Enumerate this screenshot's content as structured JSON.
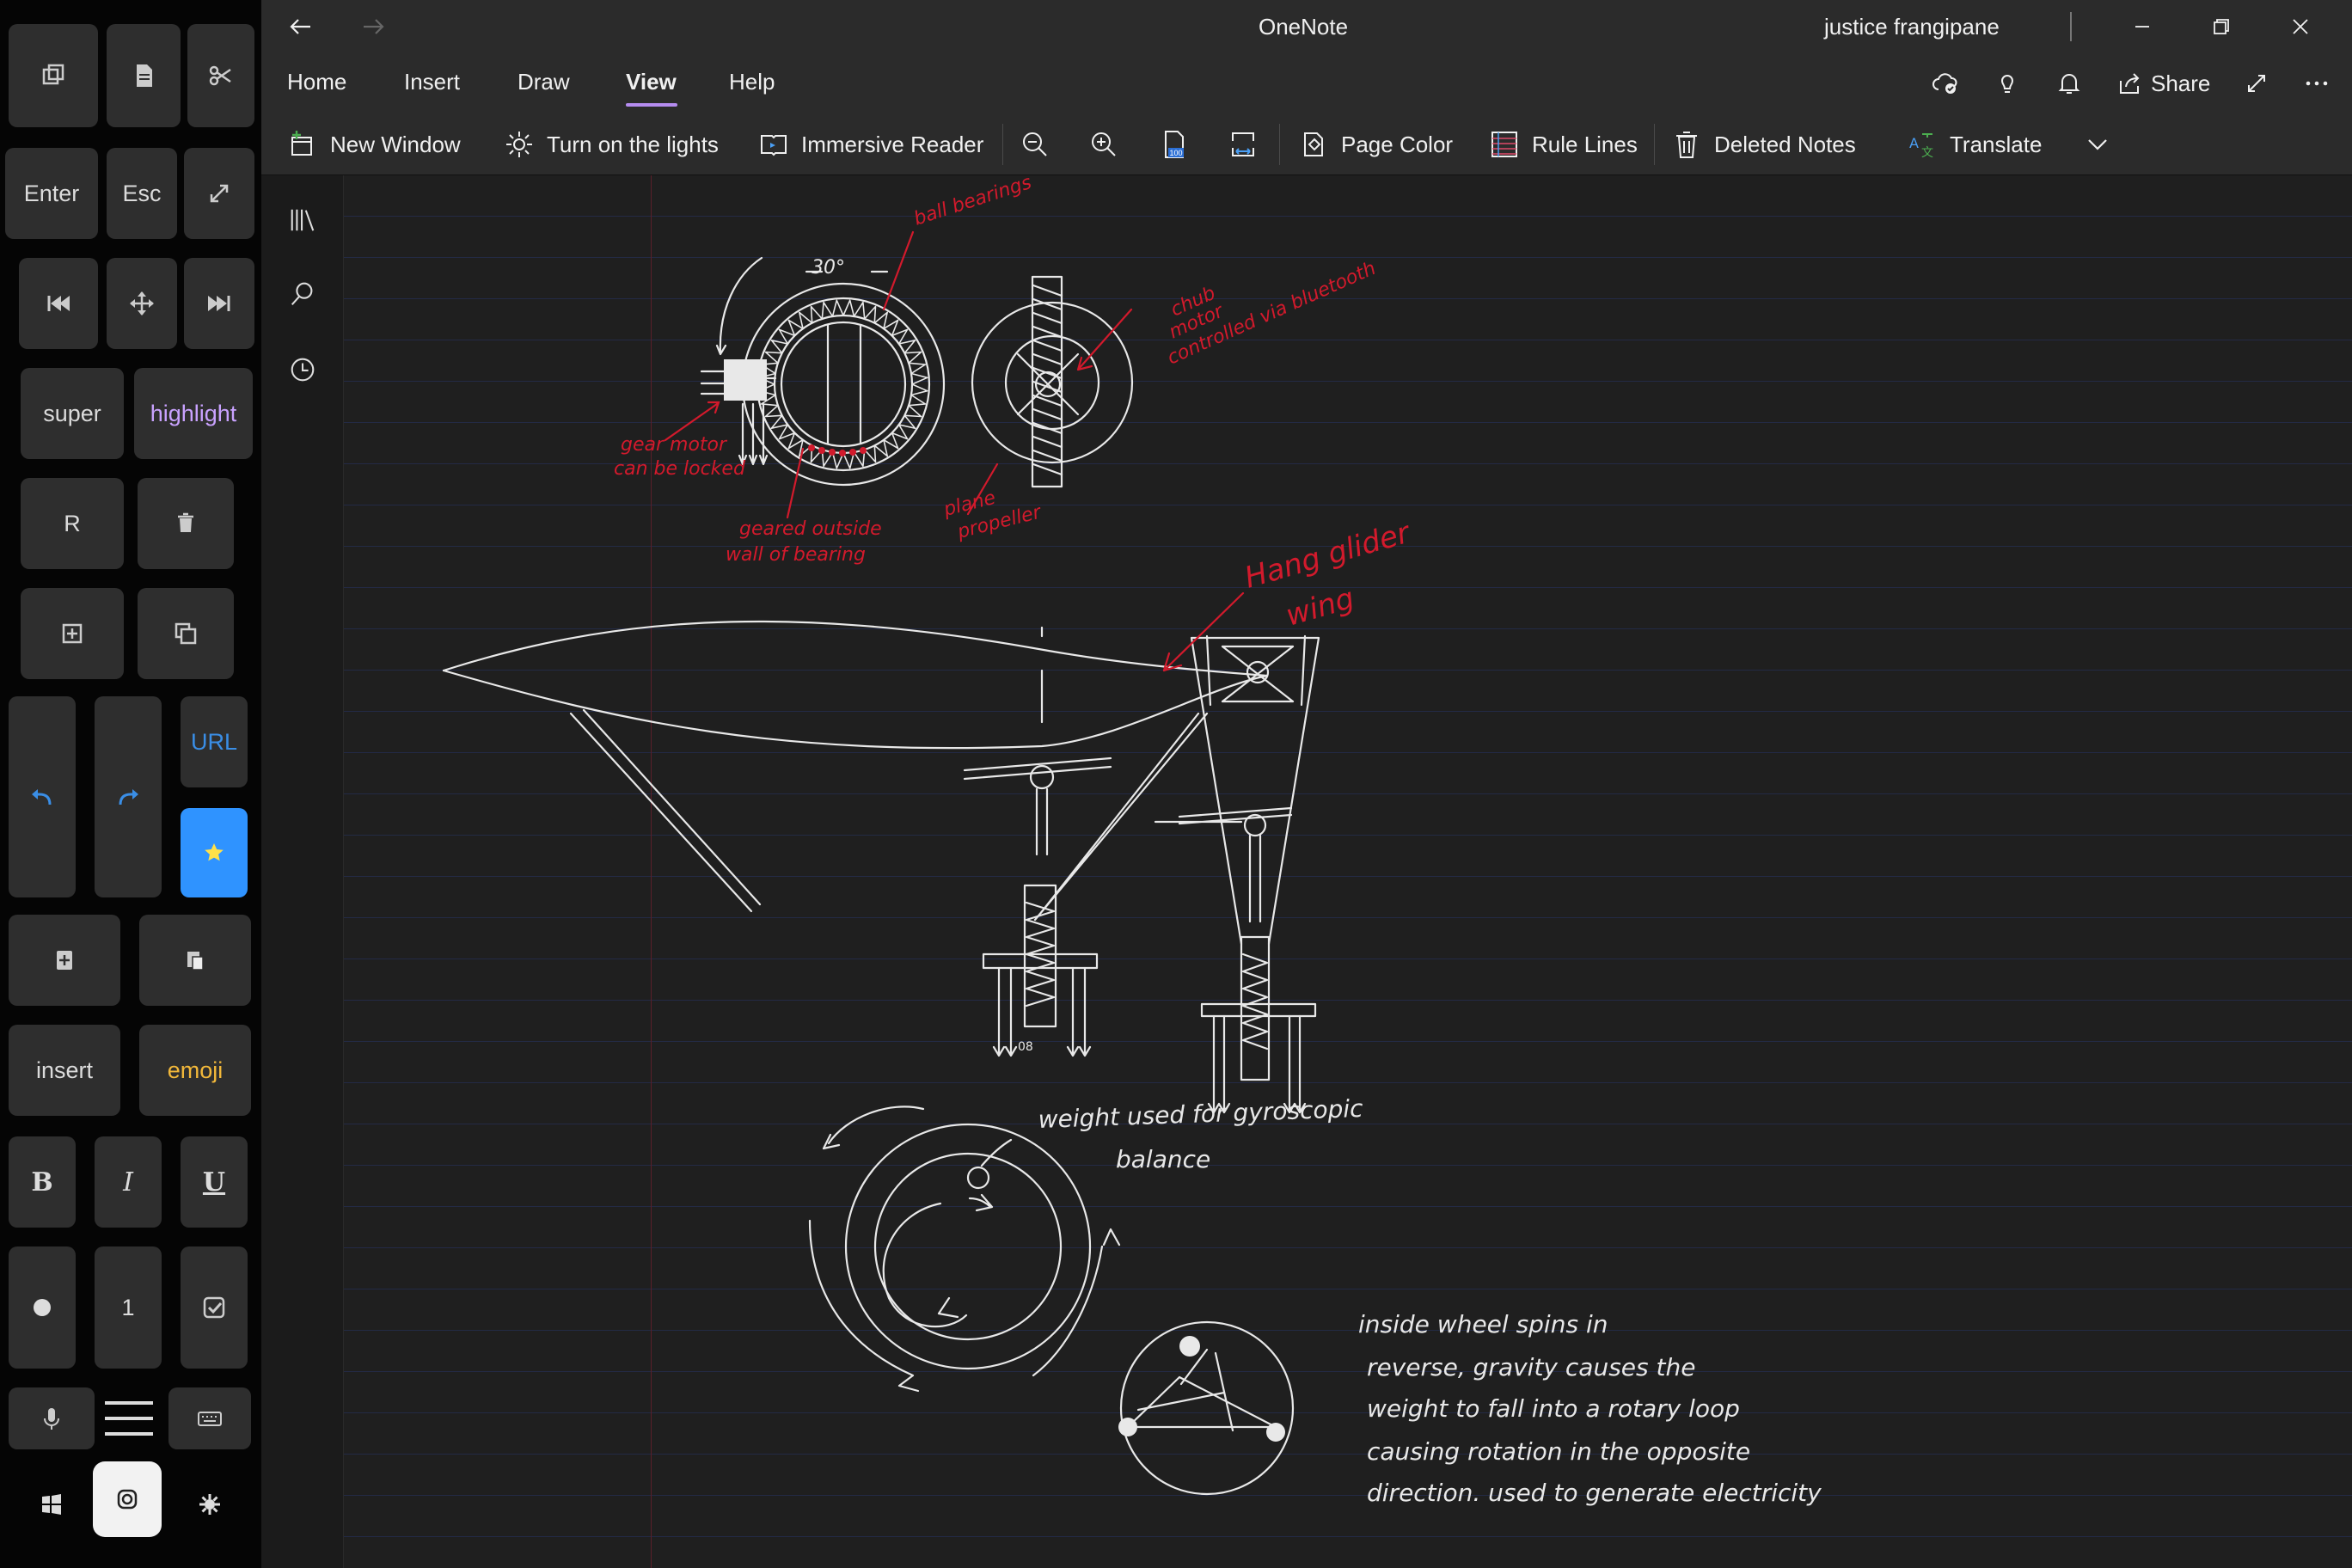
{
  "keypad": {
    "keys": [
      {
        "id": "window-icon-key",
        "label": ""
      },
      {
        "id": "document-icon-key",
        "label": ""
      },
      {
        "id": "scissors-key",
        "label": ""
      },
      {
        "id": "enter-key",
        "label": "Enter"
      },
      {
        "id": "esc-key",
        "label": "Esc"
      },
      {
        "id": "expand-key",
        "label": ""
      },
      {
        "id": "prev-track-key",
        "label": ""
      },
      {
        "id": "move-key",
        "label": ""
      },
      {
        "id": "next-track-key",
        "label": ""
      },
      {
        "id": "super-key",
        "label": "super"
      },
      {
        "id": "highlight-key",
        "label": "highlight"
      },
      {
        "id": "r-key",
        "label": "R"
      },
      {
        "id": "trash-key",
        "label": ""
      },
      {
        "id": "add-box-key",
        "label": ""
      },
      {
        "id": "copy-key",
        "label": ""
      },
      {
        "id": "undo-key",
        "label": ""
      },
      {
        "id": "redo-key",
        "label": ""
      },
      {
        "id": "url-key",
        "label": "URL"
      },
      {
        "id": "star-key",
        "label": ""
      },
      {
        "id": "add-page-key",
        "label": ""
      },
      {
        "id": "paste-key",
        "label": ""
      },
      {
        "id": "insert-key",
        "label": "insert"
      },
      {
        "id": "emoji-key",
        "label": "emoji"
      },
      {
        "id": "bold-key",
        "label": "B"
      },
      {
        "id": "italic-key",
        "label": "I"
      },
      {
        "id": "underline-key",
        "label": "U"
      },
      {
        "id": "bullet-key",
        "label": ""
      },
      {
        "id": "numbered-key",
        "label": "1"
      },
      {
        "id": "checkbox-key",
        "label": ""
      },
      {
        "id": "mic-key",
        "label": ""
      },
      {
        "id": "menu-key",
        "label": ""
      },
      {
        "id": "keyboard-key",
        "label": ""
      },
      {
        "id": "windows-key",
        "label": ""
      },
      {
        "id": "camera-key",
        "label": ""
      },
      {
        "id": "settings-key",
        "label": ""
      }
    ]
  },
  "titlebar": {
    "app_title": "OneNote",
    "user_name": "justice frangipane"
  },
  "tabs": [
    {
      "label": "Home",
      "active": false
    },
    {
      "label": "Insert",
      "active": false
    },
    {
      "label": "Draw",
      "active": false
    },
    {
      "label": "View",
      "active": true
    },
    {
      "label": "Help",
      "active": false
    }
  ],
  "header_actions": {
    "share_label": "Share"
  },
  "ribbon": {
    "new_window": "New Window",
    "lights": "Turn on the lights",
    "immersive_reader": "Immersive Reader",
    "zoom_badge": "100",
    "page_color": "Page Color",
    "rule_lines": "Rule Lines",
    "deleted_notes": "Deleted Notes",
    "translate": "Translate"
  },
  "ink_notes": {
    "ball_bearings": "ball bearings",
    "thirty_degrees": "30°",
    "gear_motor_1": "gear motor",
    "gear_motor_2": "can be locked",
    "geared_1": "geared outside",
    "geared_2": "wall of bearing",
    "chub_1": "chub",
    "chub_2": "motor",
    "chub_3": "controlled via bluetooth",
    "plane_1": "plane",
    "plane_2": "propeller",
    "hang_1": "Hang glider",
    "hang_2": "wing",
    "weight_1": "weight used for gyroscopic",
    "weight_2": "balance",
    "inside_1": "inside wheel spins in",
    "inside_2": "reverse, gravity causes the",
    "inside_3": "weight to fall into a rotary loop",
    "inside_4": "causing rotation in the opposite",
    "inside_5": "direction. used to generate electricity",
    "small_number": "08"
  },
  "colors": {
    "accent": "#b58cf0",
    "ink_red": "#d21a2c",
    "ink_white": "#e8e8e8",
    "star_key": "#2f93ff",
    "rule_line": "#232a45"
  }
}
